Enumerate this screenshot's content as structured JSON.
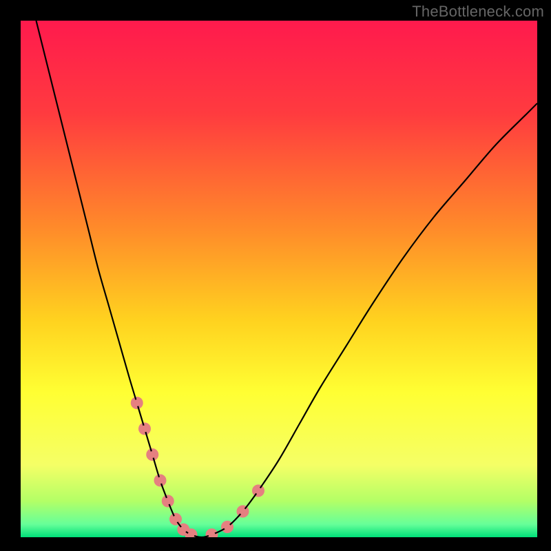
{
  "watermark": "TheBottleneck.com",
  "chart_data": {
    "type": "line",
    "title": "",
    "xlabel": "",
    "ylabel": "",
    "xlim": [
      0,
      100
    ],
    "ylim": [
      0,
      100
    ],
    "background_gradient_stops": [
      {
        "offset": 0.0,
        "color": "#ff1a4d"
      },
      {
        "offset": 0.18,
        "color": "#ff3b3f"
      },
      {
        "offset": 0.4,
        "color": "#ff8a2a"
      },
      {
        "offset": 0.58,
        "color": "#ffd21f"
      },
      {
        "offset": 0.72,
        "color": "#ffff33"
      },
      {
        "offset": 0.86,
        "color": "#f5ff66"
      },
      {
        "offset": 0.93,
        "color": "#b3ff66"
      },
      {
        "offset": 0.975,
        "color": "#66ff99"
      },
      {
        "offset": 1.0,
        "color": "#00e07a"
      }
    ],
    "series": [
      {
        "name": "curve",
        "color": "#000000",
        "x": [
          3,
          5,
          7,
          9,
          11,
          13,
          15,
          17,
          19,
          21,
          22.5,
          24,
          25.5,
          27,
          28.5,
          30,
          31.5,
          33,
          35,
          37,
          40,
          43,
          46,
          50,
          54,
          58,
          63,
          68,
          74,
          80,
          86,
          92,
          98,
          100
        ],
        "y": [
          100,
          92,
          84,
          76,
          68,
          60,
          52,
          45,
          38,
          31,
          26,
          21,
          16,
          11,
          7,
          3.5,
          1.5,
          0.5,
          0,
          0.5,
          2,
          5,
          9,
          15,
          22,
          29,
          37,
          45,
          54,
          62,
          69,
          76,
          82,
          84
        ],
        "comment": "y is percent of plot height from the bottom; x is percent from left. Values estimated from pixels; curve dips to ~0 near x≈34 and rises toward the right."
      }
    ],
    "markers": {
      "color": "#e58080",
      "outer_radius_px": 9,
      "inner_radius_px": 5,
      "points": [
        {
          "x": 22.5,
          "y": 26
        },
        {
          "x": 24.0,
          "y": 21
        },
        {
          "x": 25.5,
          "y": 16
        },
        {
          "x": 27.0,
          "y": 11
        },
        {
          "x": 28.5,
          "y": 7
        },
        {
          "x": 30.0,
          "y": 3.5
        },
        {
          "x": 31.5,
          "y": 1.5
        },
        {
          "x": 33.0,
          "y": 0.5
        },
        {
          "x": 37.0,
          "y": 0.5
        },
        {
          "x": 40.0,
          "y": 2
        },
        {
          "x": 43.0,
          "y": 5
        },
        {
          "x": 46.0,
          "y": 9
        }
      ]
    }
  }
}
